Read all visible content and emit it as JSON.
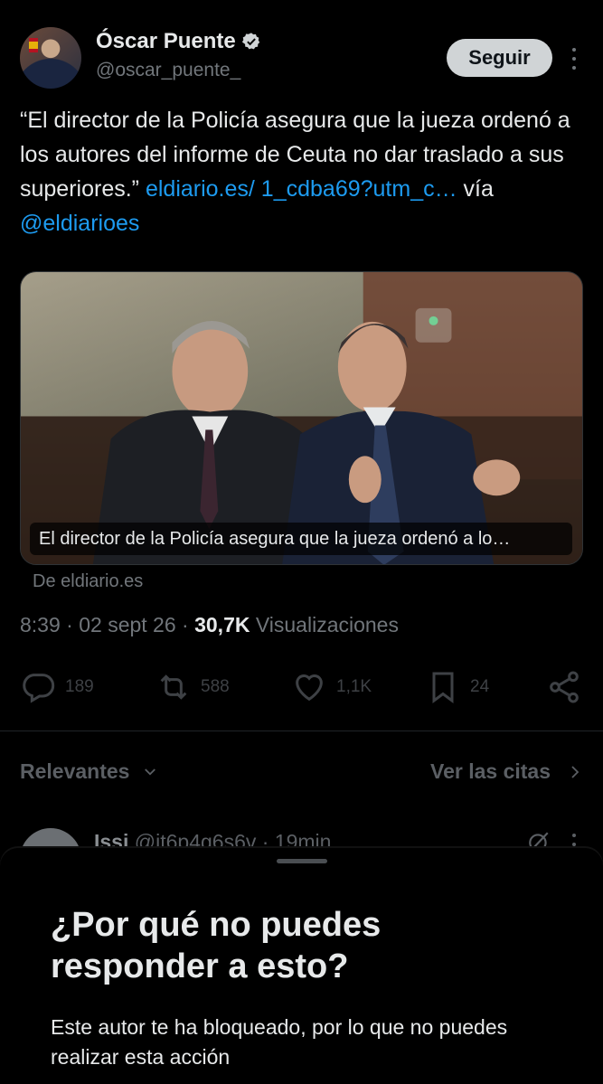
{
  "author": {
    "display_name": "Óscar Puente",
    "handle": "@oscar_puente_",
    "verified_icon": "verified-badge-icon"
  },
  "follow_label": "Seguir",
  "tweet": {
    "text_before": "“El director de la Policía asegura que la jueza ordenó a los autores del informe de Ceuta no dar traslado a sus superiores.” ",
    "link_text": "eldiario.es/ 1_cdba69?utm_c…",
    "via_text": " vía ",
    "mention": "@eldiarioes"
  },
  "card": {
    "caption": "El director de la Policía asegura que la jueza ordenó a lo…",
    "source": "De eldiario.es"
  },
  "meta": {
    "time": "8:39",
    "date": "02 sept 26",
    "views_count": "30,7K",
    "views_label": "Visualizaciones"
  },
  "actions": {
    "replies": "189",
    "reposts": "588",
    "likes": "1,1K",
    "bookmarks": "24"
  },
  "sort": {
    "left_label": "Relevantes",
    "right_label": "Ver las citas"
  },
  "reply_peek": {
    "name": "Issi",
    "handle_time": "@it6p4g6s6v · 19min"
  },
  "sheet": {
    "title": "¿Por qué no puedes responder a esto?",
    "body": "Este autor te ha bloqueado, por lo que no puedes realizar esta acción"
  },
  "colors": {
    "link": "#1d9bf0",
    "muted": "#71767b",
    "text": "#e7e9ea",
    "background": "#000000"
  }
}
